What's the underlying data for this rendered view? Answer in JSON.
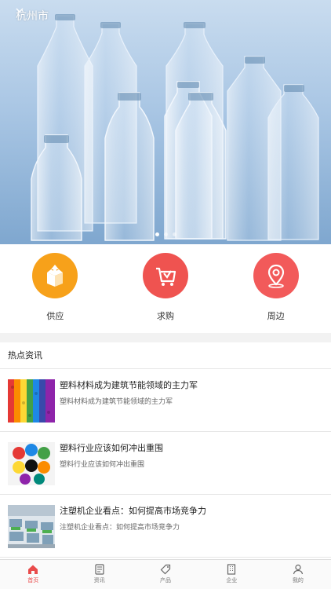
{
  "location": {
    "city": "杭州市",
    "icon": "chevron-down-icon"
  },
  "banner": {
    "slides": 3,
    "active": 0
  },
  "categories": [
    {
      "label": "供应",
      "icon": "box-icon",
      "color": "#f7a11a"
    },
    {
      "label": "求购",
      "icon": "cart-icon",
      "color": "#ef5350"
    },
    {
      "label": "周边",
      "icon": "location-pin-icon",
      "color": "#f25a5a"
    }
  ],
  "news": {
    "title": "热点资讯",
    "items": [
      {
        "title": "塑料材料成为建筑节能领域的主力军",
        "subtitle": "塑料材料成为建筑节能领域的主力军"
      },
      {
        "title": "塑料行业应该如何冲出重围",
        "subtitle": "塑料行业应该如何冲出重围"
      },
      {
        "title": "注塑机企业看点：如何提高市场竞争力",
        "subtitle": "注塑机企业看点：如何提高市场竞争力"
      }
    ]
  },
  "tabbar": [
    {
      "label": "首页",
      "icon": "home-icon",
      "active": true
    },
    {
      "label": "资讯",
      "icon": "document-icon",
      "active": false
    },
    {
      "label": "产品",
      "icon": "tag-icon",
      "active": false
    },
    {
      "label": "企业",
      "icon": "building-icon",
      "active": false
    },
    {
      "label": "我的",
      "icon": "user-icon",
      "active": false
    }
  ],
  "colors": {
    "accent": "#e94b4b"
  }
}
